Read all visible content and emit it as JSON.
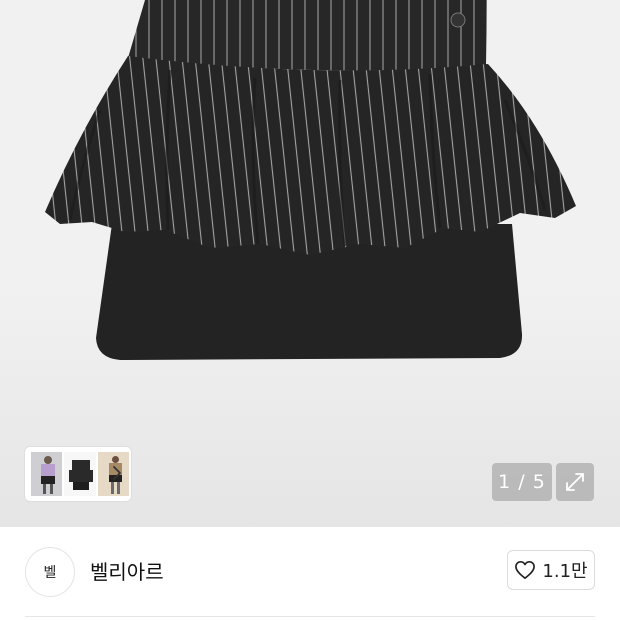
{
  "gallery": {
    "page_counter": "1 / 5",
    "thumbnails": [
      "model-front-photo",
      "skirt-flat-photo",
      "model-side-photo"
    ],
    "next_thumbs_icon": "chevron-right-icon",
    "expand_icon": "expand-diagonal-icon"
  },
  "product_image": {
    "subject": "black pinstripe peplum mini skirt",
    "colors": {
      "fabric": "#262626",
      "stripe": "#9a9a9a",
      "background": "#f1f1f1"
    }
  },
  "store": {
    "logo_text": "벨",
    "name": "벨리아르",
    "like_icon": "heart-outline-icon",
    "like_count": "1.1만"
  }
}
